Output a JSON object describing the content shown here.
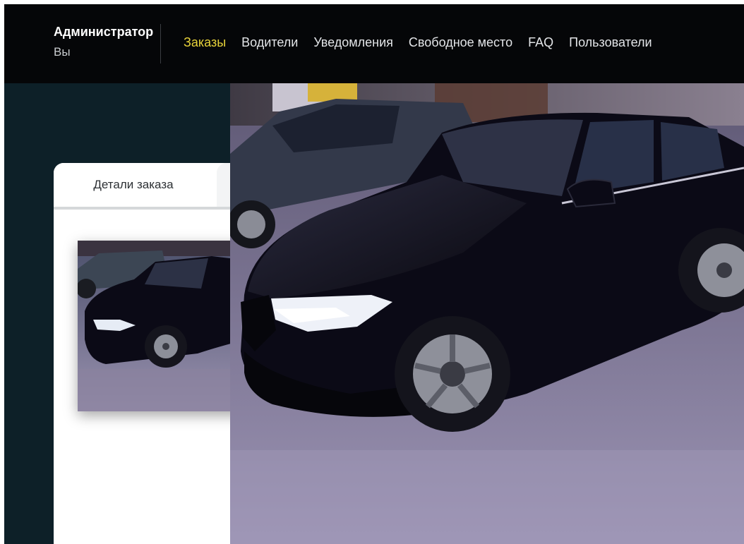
{
  "header": {
    "user_name": "Администратор",
    "user_role": "Вы"
  },
  "nav": {
    "items": [
      {
        "label": "Заказы",
        "active": true
      },
      {
        "label": "Водители",
        "active": false
      },
      {
        "label": "Уведомления",
        "active": false
      },
      {
        "label": "Свободное место",
        "active": false
      },
      {
        "label": "FAQ",
        "active": false
      },
      {
        "label": "Пользователи",
        "active": false
      }
    ]
  },
  "panel": {
    "tabs": [
      "Детали заказа",
      ""
    ]
  },
  "colors": {
    "background": "#0d2028",
    "topbar": "#050608",
    "nav_active": "#e8d33a",
    "nav_text": "#e3e5e8",
    "car_body": "#0b0a16"
  },
  "photo": {
    "subject": "black-sedan-photo"
  }
}
